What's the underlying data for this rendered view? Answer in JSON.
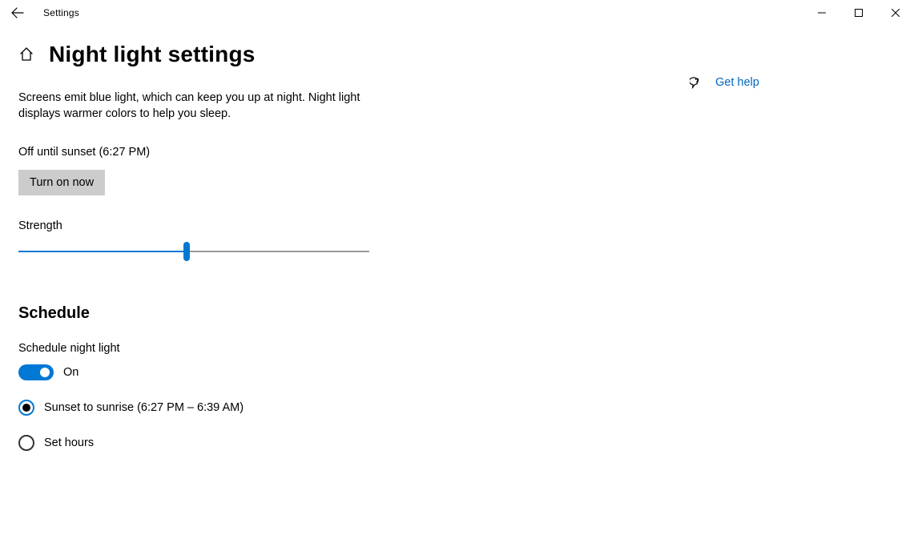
{
  "window": {
    "title": "Settings"
  },
  "page": {
    "title": "Night light settings",
    "description": "Screens emit blue light, which can keep you up at night. Night light displays warmer colors to help you sleep.",
    "status": "Off until sunset (6:27 PM)",
    "turn_on_button": "Turn on now"
  },
  "strength": {
    "label": "Strength",
    "value": 48,
    "min": 0,
    "max": 100
  },
  "schedule": {
    "heading": "Schedule",
    "toggle_label": "Schedule night light",
    "toggle_state_label": "On",
    "toggle_on": true,
    "options": [
      {
        "label": "Sunset to sunrise (6:27 PM – 6:39 AM)",
        "selected": true
      },
      {
        "label": "Set hours",
        "selected": false
      }
    ]
  },
  "side": {
    "help_link": "Get help"
  }
}
